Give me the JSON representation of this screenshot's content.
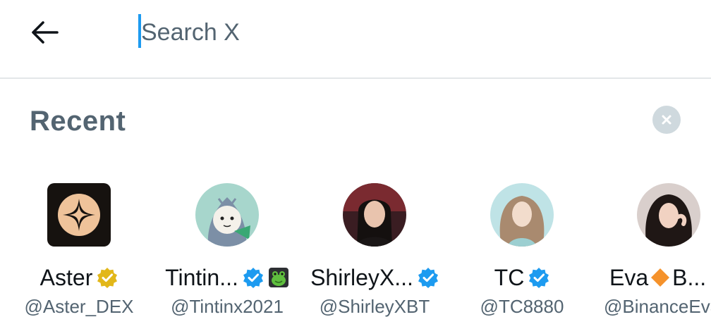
{
  "search": {
    "placeholder": "Search X",
    "value": ""
  },
  "recent": {
    "title": "Recent"
  },
  "accounts": [
    {
      "name": "Aster",
      "handle": "@Aster_DEX",
      "badge": "gold-verified-icon"
    },
    {
      "name": "Tintin...",
      "handle": "@Tintinx2021",
      "badge": "blue-verified-icon",
      "extra": "frog-emoji"
    },
    {
      "name": "ShirleyX...",
      "handle": "@ShirleyXBT",
      "badge": "blue-verified-icon"
    },
    {
      "name": "TC",
      "handle": "@TC8880",
      "badge": "blue-verified-icon"
    },
    {
      "name_before": "Eva",
      "name_after": "B...",
      "handle": "@BinanceEva",
      "extra": "orange-diamond-emoji"
    }
  ],
  "colors": {
    "accent": "#1d9bf0",
    "text_primary": "#0f1419",
    "text_secondary": "#536471",
    "gold_badge": "#e2b719",
    "divider": "#e3e6e9"
  }
}
